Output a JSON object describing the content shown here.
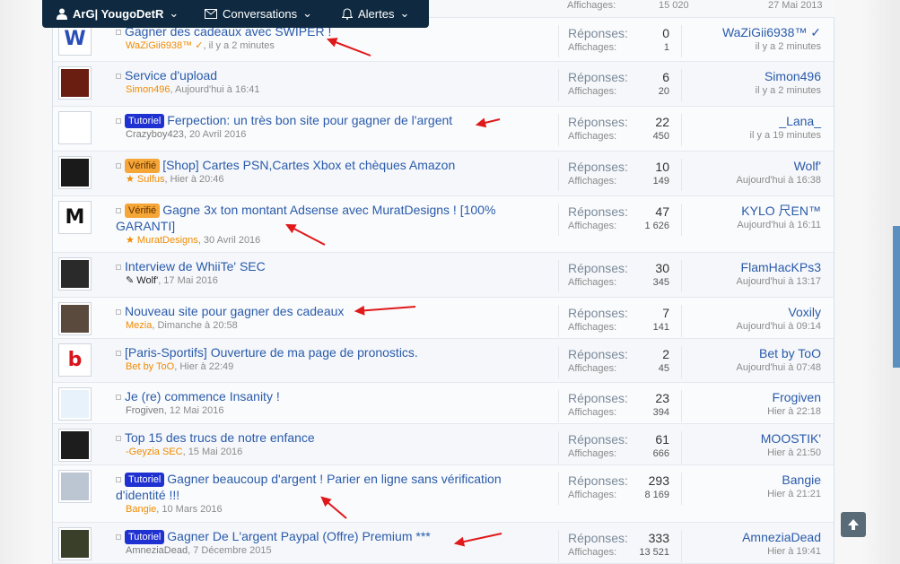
{
  "topbar": {
    "user_label": "ArG| YougoDetR",
    "conversations_label": "Conversations",
    "alerts_label": "Alertes"
  },
  "partial_row": {
    "views_label": "Affichages:",
    "views_value": "15 020",
    "date": "27 Mai 2013"
  },
  "labels": {
    "replies": "Réponses:",
    "views": "Affichages:"
  },
  "threads": [
    {
      "title": "Gagner des cadeaux avec SWIPER !",
      "prefix": "",
      "author": "WaZiGii6938™ ✓",
      "author_color": "orange",
      "date": "il y a 2 minutes",
      "replies": "0",
      "views": "1",
      "last_user": "WaZiGii6938™ ✓",
      "last_time": "il y a 2 minutes",
      "avatar_color": "#ffffff",
      "avatar_glyph": "W",
      "glyph_color": "#2a4fb8"
    },
    {
      "title": "Service d'upload",
      "prefix": "",
      "author": "Simon496",
      "author_color": "orange",
      "date": "Aujourd'hui à 16:41",
      "replies": "6",
      "views": "20",
      "last_user": "Simon496",
      "last_time": "il y a 2 minutes",
      "avatar_color": "#6a1e12",
      "avatar_glyph": "",
      "glyph_color": "#ffffff"
    },
    {
      "title": "Ferpection: un très bon site pour gagner de l'argent",
      "prefix": "Tutoriel",
      "author": "Crazyboy423",
      "author_color": "gray",
      "date": "20 Avril 2016",
      "replies": "22",
      "views": "450",
      "last_user": "_Lana_",
      "last_time": "il y a 19 minutes",
      "avatar_color": "#ffffff",
      "avatar_glyph": "",
      "glyph_color": "#d22"
    },
    {
      "title": "[Shop] Cartes PSN,Cartes Xbox et chèques Amazon",
      "prefix": "Vérifié",
      "author": "★ Sulfus",
      "author_color": "orange",
      "date": "Hier à 20:46",
      "replies": "10",
      "views": "149",
      "last_user": "Wolf'",
      "last_time": "Aujourd'hui à 16:38",
      "avatar_color": "#1a1a1a",
      "avatar_glyph": "",
      "glyph_color": "#ffffff"
    },
    {
      "title": "Gagne 3x ton montant Adsense avec MuratDesigns ! [100% GARANTI]",
      "prefix": "Vérifié",
      "author": "★ MuratDesigns",
      "author_color": "orange",
      "date": "30 Avril 2016",
      "replies": "47",
      "views": "1 626",
      "last_user": "KYLO 尺EN™",
      "last_time": "Aujourd'hui à 16:11",
      "avatar_color": "#ffffff",
      "avatar_glyph": "M",
      "glyph_color": "#111111"
    },
    {
      "title": "Interview de WhiiTe' SEC",
      "prefix": "",
      "author": "✎ Wolf'",
      "author_color": "dark",
      "date": "17 Mai 2016",
      "replies": "30",
      "views": "345",
      "last_user": "FlamHacKPs3",
      "last_time": "Aujourd'hui à 13:17",
      "avatar_color": "#2a2a2a",
      "avatar_glyph": "",
      "glyph_color": "#ffffff"
    },
    {
      "title": "Nouveau site pour gagner des cadeaux",
      "prefix": "",
      "author": "Mezia",
      "author_color": "orange",
      "date": "Dimanche à 20:58",
      "replies": "7",
      "views": "141",
      "last_user": "Voxily",
      "last_time": "Aujourd'hui à 09:14",
      "avatar_color": "#5a4a3e",
      "avatar_glyph": "",
      "glyph_color": "#ffffff"
    },
    {
      "title": "[Paris-Sportifs] Ouverture de ma page de pronostics.",
      "prefix": "",
      "author": "Bet by ToO",
      "author_color": "orange",
      "date": "Hier à 22:49",
      "replies": "2",
      "views": "45",
      "last_user": "Bet by ToO",
      "last_time": "Aujourd'hui à 07:48",
      "avatar_color": "#ffffff",
      "avatar_glyph": "b",
      "glyph_color": "#d8141c"
    },
    {
      "title": "Je (re) commence Insanity !",
      "prefix": "",
      "author": "Frogiven",
      "author_color": "gray",
      "date": "12 Mai 2016",
      "replies": "23",
      "views": "394",
      "last_user": "Frogiven",
      "last_time": "Hier à 22:18",
      "avatar_color": "#e8f2fb",
      "avatar_glyph": "",
      "glyph_color": "#1e7fd4"
    },
    {
      "title": "Top 15 des trucs de notre enfance",
      "prefix": "",
      "author": "-Geyzia SEC",
      "author_color": "orange",
      "date": "15 Mai 2016",
      "replies": "61",
      "views": "666",
      "last_user": "MOOSTIK'",
      "last_time": "Hier à 21:50",
      "avatar_color": "#1d1d1d",
      "avatar_glyph": "",
      "glyph_color": "#ffffff"
    },
    {
      "title": "Gagner beaucoup d'argent ! Parier en ligne sans vérification d'identité !!!",
      "prefix": "Tutoriel",
      "author": "Bangie",
      "author_color": "orange",
      "date": "10 Mars 2016",
      "replies": "293",
      "views": "8 169",
      "last_user": "Bangie",
      "last_time": "Hier à 21:21",
      "avatar_color": "#bcc6d2",
      "avatar_glyph": "",
      "glyph_color": "#ffffff"
    },
    {
      "title": "Gagner De L'argent Paypal (Offre) Premium ***",
      "prefix": "Tutoriel",
      "author": "AmneziaDead",
      "author_color": "gray",
      "date": "7 Décembre 2015",
      "replies": "333",
      "views": "13 521",
      "last_user": "AmneziaDead",
      "last_time": "Hier à 19:41",
      "avatar_color": "#3a3f2a",
      "avatar_glyph": "",
      "glyph_color": "#ffffff"
    }
  ],
  "icons": {
    "user": "user-icon",
    "conversations": "envelope-icon",
    "alerts": "bell-icon",
    "back_to_top": "arrow-up-icon"
  },
  "colors": {
    "topbar_bg": "#0f2a40",
    "link": "#2a5bab",
    "tutoriel_badge": "#1f31d1",
    "verifie_badge": "#f6a637",
    "annotation_arrow": "#e0191b"
  }
}
